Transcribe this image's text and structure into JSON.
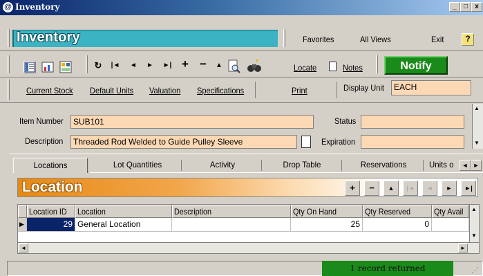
{
  "window": {
    "title": "Inventory",
    "min_label": "_",
    "max_label": "□",
    "close_label": "x",
    "help_label": "?"
  },
  "header": {
    "banner": "Inventory",
    "links": {
      "favorites": "Favorites",
      "all_views": "All Views",
      "exit": "Exit"
    }
  },
  "toolbar": {
    "nav": {
      "refresh": "↻",
      "first": "|◄",
      "prev": "◄",
      "next": "►",
      "last": "►|",
      "add": "+",
      "delete": "−",
      "up": "▲"
    },
    "locate_label": "Locate",
    "notes_label": "Notes",
    "notify_label": "Notify"
  },
  "menu": {
    "current_stock": "Current Stock",
    "default_units": "Default Units",
    "valuation": "Valuation",
    "specifications": "Specifications",
    "print": "Print",
    "display_unit_label": "Display Unit",
    "display_unit_value": "EACH"
  },
  "item": {
    "number_label": "Item Number",
    "number_value": "SUB101",
    "description_label": "Description",
    "description_value": "Threaded Rod Welded to Guide Pulley Sleeve",
    "status_label": "Status",
    "status_value": "",
    "expiration_label": "Expiration",
    "expiration_value": ""
  },
  "tabs": [
    "Locations",
    "Lot Quantities",
    "Activity",
    "Drop Table",
    "Reservations",
    "Units o"
  ],
  "location_section": {
    "title": "Location",
    "nav": {
      "add": "+",
      "delete": "−",
      "up": "▲",
      "first": "|◄",
      "prev": "◄",
      "next": "►",
      "last": "►|"
    }
  },
  "grid": {
    "columns": [
      "Location ID",
      "Location",
      "Description",
      "Qty On Hand",
      "Qty Reserved",
      "Qty Avail"
    ],
    "rows": [
      {
        "location_id": "29",
        "location": "General Location",
        "description": "",
        "qty_on_hand": "25",
        "qty_reserved": "0",
        "qty_avail": ""
      }
    ]
  },
  "status_bar": {
    "message": "1 record returned"
  },
  "colors": {
    "field_bg": "#fcd9b4",
    "banner": "#3bb3c3",
    "notify_green": "#1a8a1a",
    "location_orange": "#e68a16"
  }
}
